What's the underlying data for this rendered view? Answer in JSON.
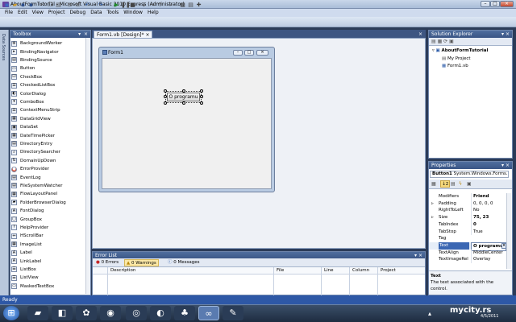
{
  "window": {
    "title": "AboutFormTutorial - Microsoft Visual Basic 2010 Express (Administrator)"
  },
  "menu": [
    "File",
    "Edit",
    "View",
    "Project",
    "Debug",
    "Data",
    "Tools",
    "Window",
    "Help"
  ],
  "strip_label": "Data Sources",
  "toolbox": {
    "title": "Toolbox",
    "pin": "▾ ⁣ ×",
    "items": [
      "BackgroundWorker",
      "BindingNavigator",
      "BindingSource",
      "Button",
      "CheckBox",
      "CheckedListBox",
      "ColorDialog",
      "ComboBox",
      "ContextMenuStrip",
      "DataGridView",
      "DataSet",
      "DateTimePicker",
      "DirectoryEntry",
      "DirectorySearcher",
      "DomainUpDown",
      "ErrorProvider",
      "EventLog",
      "FileSystemWatcher",
      "FlowLayoutPanel",
      "FolderBrowserDialog",
      "FontDialog",
      "GroupBox",
      "HelpProvider",
      "HScrollBar",
      "ImageList",
      "Label",
      "LinkLabel",
      "ListBox",
      "ListView",
      "MaskedTextBox"
    ]
  },
  "doc": {
    "tab": "Form1.vb [Design]*",
    "tab_close": "×",
    "form_title": "Form1",
    "button_text": "O programu"
  },
  "errors": {
    "title": "Error List",
    "errors": "0 Errors",
    "warnings": "0 Warnings",
    "messages": "0 Messages",
    "columns": [
      "Description",
      "File",
      "Line",
      "Column",
      "Project"
    ]
  },
  "solution": {
    "title": "Solution Explorer",
    "project": "AboutFormTutorial",
    "items": [
      "My Project",
      "Form1.vb"
    ]
  },
  "properties": {
    "title": "Properties",
    "object_name": "Button1",
    "object_type": "System.Windows.Forms.I",
    "rows": [
      {
        "name": "Modifiers",
        "value": "Friend",
        "bold": true,
        "expand": ""
      },
      {
        "name": "Padding",
        "value": "0, 0, 0, 0",
        "bold": false,
        "expand": "▹"
      },
      {
        "name": "RightToLeft",
        "value": "No",
        "bold": false,
        "expand": ""
      },
      {
        "name": "Size",
        "value": "75, 23",
        "bold": true,
        "expand": "▹"
      },
      {
        "name": "TabIndex",
        "value": "0",
        "bold": true,
        "expand": ""
      },
      {
        "name": "TabStop",
        "value": "True",
        "bold": false,
        "expand": ""
      },
      {
        "name": "Tag",
        "value": "",
        "bold": false,
        "expand": ""
      },
      {
        "name": "Text",
        "value": "O programu",
        "bold": true,
        "expand": "",
        "selected": true
      },
      {
        "name": "TextAlign",
        "value": "MiddleCenter",
        "bold": false,
        "expand": ""
      },
      {
        "name": "TextImageRel",
        "value": "Overlay",
        "bold": false,
        "expand": ""
      }
    ],
    "desc_title": "Text",
    "desc": "The text associated with the control."
  },
  "status": "Ready",
  "taskbar": {
    "watermark": "mycity.rs",
    "date": "4/5/2011"
  }
}
